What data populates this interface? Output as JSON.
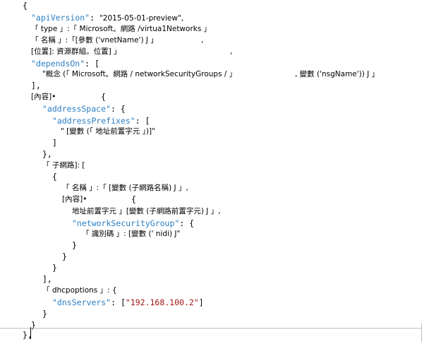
{
  "code": {
    "l01_open": "{",
    "l02_key": "\"apiVersion\"",
    "l02_colon": ": ",
    "l02_val": "\"2015-05-01-preview\",",
    "l03": "「 type 」:「 Microsoft。網路 /virtua1Networks 」",
    "l04": "「 名稱 」:「[參數 ('vnetName') J 」",
    "l04_comma": ",",
    "l05": "[位置]: 資源群組。位置] 」",
    "l05_comma": ",",
    "l06_key": "\"dependsOn\"",
    "l06_rest": ": [",
    "l07": "\"概念 (「 Microsoft。網路 / networkSecurityGroups / 」",
    "l07_b": ", 變數 ('nsgName')) J 」",
    "l08": "],",
    "l09": "[內容]•",
    "l09_brace": "{",
    "l10_key": "\"addressSpace\"",
    "l10_rest": ": {",
    "l11_key": "\"addressPrefixes\"",
    "l11_rest": ": [",
    "l12": "\" [變數 (「 地址前置字元 」)]\"",
    "l13": "]",
    "l14": "},",
    "l15": "「 子網路]: [",
    "l16": "{",
    "l17": "「 名稱 」:「 [變數 (子網路名稱) J 」,",
    "l18": "[內容]•",
    "l18_brace": "{",
    "l19": "地址前置字元 」[變數 (子網路前置字元) J 」,",
    "l20_key": "\"networkSecurityGroup\"",
    "l20_rest": ": {",
    "l21": "「 識別碼 」: [變數 (' nidi) J\"",
    "l22": "}",
    "l23": "}",
    "l24": "}",
    "l25": "],",
    "l26": "「 dhcpoptions 」: {",
    "l27_key": "\"dnsServers\"",
    "l27_colon": ": [",
    "l27_val": "\"192.168.100.2\"",
    "l27_end": "]",
    "l28": "}",
    "l29": "}",
    "l30": "},"
  },
  "colors": {
    "key": "#2b7fc4",
    "string": "#a31515",
    "text": "#000000"
  }
}
